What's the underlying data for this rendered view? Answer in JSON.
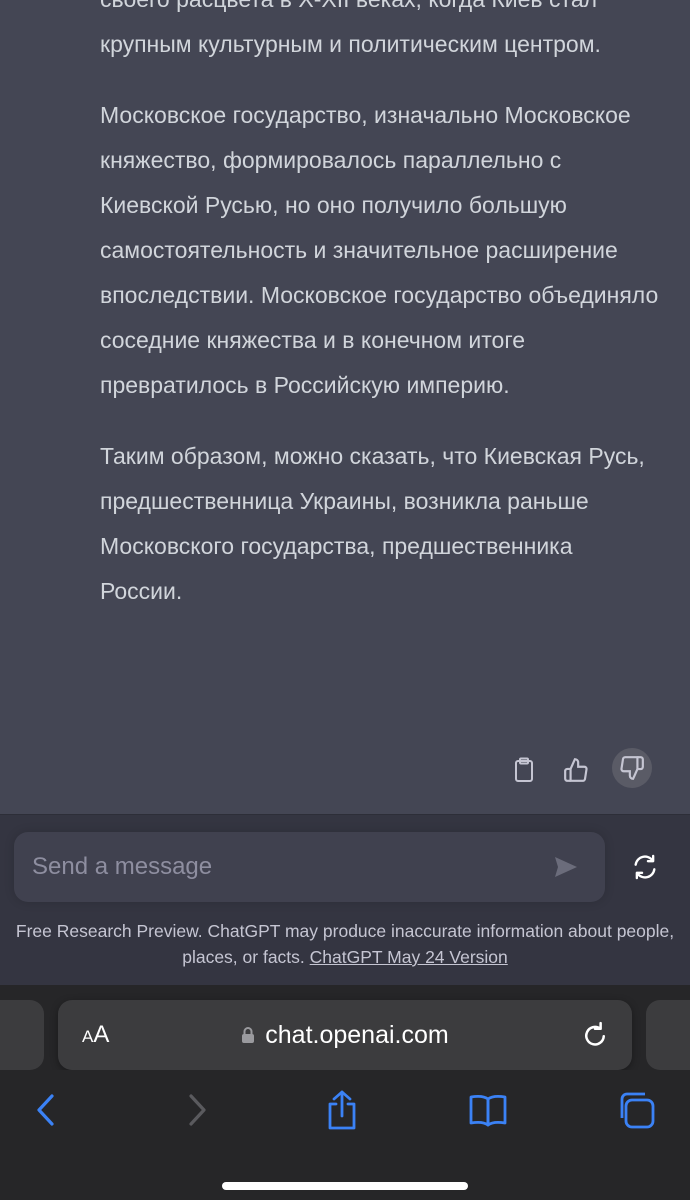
{
  "message": {
    "paragraphs": [
      "своего расцвета в X-XII веках, когда Киев стал крупным культурным и политическим центром.",
      "Московское государство, изначально Московское княжество, формировалось параллельно с Киевской Русью, но оно получило большую самостоятельность и значительное расширение впоследствии. Московское государство объединяло соседние княжества и в конечном итоге превратилось в Российскую империю.",
      "Таким образом, можно сказать, что Киевская Русь, предшественница Украины, возникла раньше Московского государства, предшественника России."
    ]
  },
  "composer": {
    "placeholder": "Send a message"
  },
  "disclaimer": {
    "text": "Free Research Preview. ChatGPT may produce inaccurate information about people, places, or facts.",
    "link": "ChatGPT May 24 Version"
  },
  "browser": {
    "text_size_label_small": "A",
    "text_size_label_large": "A",
    "url": "chat.openai.com"
  },
  "colors": {
    "message_bg": "#444654",
    "page_bg": "#343541",
    "browser_bg": "#262628",
    "accent_blue": "#3b82f6"
  }
}
